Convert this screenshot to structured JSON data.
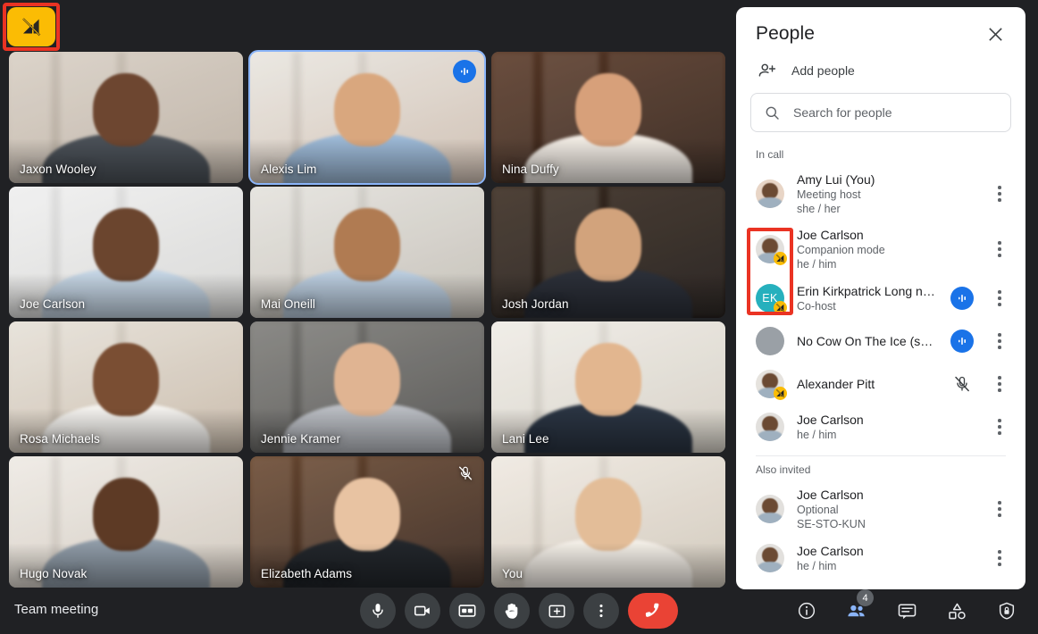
{
  "app": {
    "background_color": "#202124",
    "meeting_title": "Team meeting"
  },
  "highlight": {
    "button_icon": "network-off-icon",
    "button_color": "#fbbc04",
    "outline_color": "#ea3323"
  },
  "grid": {
    "tiles": [
      {
        "name": "Jaxon Wooley",
        "active_speaker": false,
        "audio_indicator": false,
        "muted": false,
        "skin": "#6d4630",
        "shirt": "#4a5057",
        "bg1": "#d8cfc4",
        "bg2": "#b9ada0"
      },
      {
        "name": "Alexis Lim",
        "active_speaker": true,
        "audio_indicator": true,
        "muted": false,
        "skin": "#d9a77e",
        "shirt": "#9bb7d4",
        "bg1": "#e9e6e0",
        "bg2": "#cdbcae"
      },
      {
        "name": "Nina Duffy",
        "active_speaker": false,
        "audio_indicator": false,
        "muted": false,
        "skin": "#d7a07a",
        "shirt": "#f0eae3",
        "bg1": "#5a3a28",
        "bg2": "#2e1d14"
      },
      {
        "name": "Joe Carlson",
        "active_speaker": false,
        "audio_indicator": false,
        "muted": false,
        "skin": "#6b452e",
        "shirt": "#c3d3e2",
        "bg1": "#efefef",
        "bg2": "#d6d6d4"
      },
      {
        "name": "Mai Oneill",
        "active_speaker": false,
        "audio_indicator": false,
        "muted": false,
        "skin": "#b07b52",
        "shirt": "#b9cbdd",
        "bg1": "#e4e2dd",
        "bg2": "#c2bdb4"
      },
      {
        "name": "Josh Jordan",
        "active_speaker": false,
        "audio_indicator": false,
        "muted": false,
        "skin": "#d2a37c",
        "shirt": "#2b2f38",
        "bg1": "#3b2d22",
        "bg2": "#191310"
      },
      {
        "name": "Rosa Michaels",
        "active_speaker": false,
        "audio_indicator": false,
        "muted": false,
        "skin": "#7a4e33",
        "shirt": "#f2f0ec",
        "bg1": "#e6e1d8",
        "bg2": "#c6b7a6"
      },
      {
        "name": "Jennie Kramer",
        "active_speaker": false,
        "audio_indicator": false,
        "muted": false,
        "skin": "#e0b492",
        "shirt": "#b9bcc2",
        "bg1": "#7e7d79",
        "bg2": "#4c4b49"
      },
      {
        "name": "Lani Lee",
        "active_speaker": false,
        "audio_indicator": false,
        "muted": false,
        "skin": "#e2b68f",
        "shirt": "#2a3442",
        "bg1": "#efece6",
        "bg2": "#d4cec3"
      },
      {
        "name": "Hugo Novak",
        "active_speaker": false,
        "audio_indicator": false,
        "muted": false,
        "skin": "#5d3a25",
        "shirt": "#8e9aa6",
        "bg1": "#eeeae4",
        "bg2": "#cfc6bb"
      },
      {
        "name": "Elizabeth Adams",
        "active_speaker": false,
        "audio_indicator": false,
        "muted": true,
        "skin": "#e8c3a2",
        "shirt": "#22262b",
        "bg1": "#6b4a32",
        "bg2": "#332118"
      },
      {
        "name": "You",
        "active_speaker": false,
        "audio_indicator": false,
        "muted": false,
        "skin": "#e3bd98",
        "shirt": "#f1ece5",
        "bg1": "#efe9e1",
        "bg2": "#cfc6b8"
      }
    ]
  },
  "panel": {
    "title": "People",
    "close_icon": "close-icon",
    "add_people": {
      "label": "Add people",
      "icon": "person-add-icon"
    },
    "search": {
      "placeholder": "Search for people",
      "value": "",
      "icon": "search-icon"
    },
    "sections": [
      {
        "label": "In call",
        "people": [
          {
            "name": "Amy Lui (You)",
            "sub1": "Meeting host",
            "sub2": "she / her",
            "avatar_type": "photo",
            "avatar_color": "#e8d5c6",
            "badge": null,
            "audio_indicator": false,
            "muted": false,
            "menu": true
          },
          {
            "name": "Joe Carlson",
            "sub1": "Companion mode",
            "sub2": "he / him",
            "avatar_type": "photo",
            "avatar_color": "#e2e0dd",
            "badge": "companion-mode-icon",
            "audio_indicator": false,
            "muted": false,
            "menu": true
          },
          {
            "name": "Erin Kirkpatrick Long nam...",
            "sub1": "Co-host",
            "sub2": "",
            "avatar_type": "initials",
            "initials": "EK",
            "avatar_color": "#26b0bd",
            "badge": "companion-mode-icon",
            "audio_indicator": true,
            "muted": false,
            "menu": true
          },
          {
            "name": "No Cow On The Ice (se-sto..",
            "sub1": "",
            "sub2": "",
            "avatar_type": "blank",
            "avatar_color": "#9aa0a6",
            "badge": null,
            "audio_indicator": true,
            "muted": false,
            "menu": true
          },
          {
            "name": "Alexander Pitt",
            "sub1": "",
            "sub2": "",
            "avatar_type": "photo",
            "avatar_color": "#e6e3de",
            "badge": "companion-mode-icon",
            "audio_indicator": false,
            "muted": true,
            "menu": true
          },
          {
            "name": "Joe Carlson",
            "sub1": "he / him",
            "sub2": "",
            "avatar_type": "photo",
            "avatar_color": "#e2e0dd",
            "badge": null,
            "audio_indicator": false,
            "muted": false,
            "menu": true
          }
        ]
      },
      {
        "label": "Also invited",
        "people": [
          {
            "name": "Joe Carlson",
            "sub1": "Optional",
            "sub2": "SE-STO-KUN",
            "avatar_type": "photo",
            "avatar_color": "#e2e0dd",
            "badge": null,
            "audio_indicator": false,
            "muted": false,
            "menu": true
          },
          {
            "name": "Joe Carlson",
            "sub1": "he / him",
            "sub2": "",
            "avatar_type": "photo",
            "avatar_color": "#e2e0dd",
            "badge": null,
            "audio_indicator": false,
            "muted": false,
            "menu": true
          }
        ]
      }
    ],
    "row_highlight": {
      "outline_color": "#ea3323"
    }
  },
  "bottom_bar": {
    "center_controls": [
      {
        "name": "microphone-button",
        "icon": "mic-icon",
        "style": "normal"
      },
      {
        "name": "camera-button",
        "icon": "video-camera-icon",
        "style": "normal"
      },
      {
        "name": "captions-button",
        "icon": "closed-caption-icon",
        "style": "normal"
      },
      {
        "name": "raise-hand-button",
        "icon": "hand-icon",
        "style": "normal"
      },
      {
        "name": "present-screen-button",
        "icon": "present-screen-icon",
        "style": "normal"
      },
      {
        "name": "more-options-button",
        "icon": "more-vertical-icon",
        "style": "normal"
      },
      {
        "name": "end-call-button",
        "icon": "call-end-icon",
        "style": "end"
      }
    ],
    "right_controls": [
      {
        "name": "meeting-details-button",
        "icon": "info-icon",
        "active": false,
        "badge": null
      },
      {
        "name": "people-button",
        "icon": "people-icon",
        "active": true,
        "badge": "4"
      },
      {
        "name": "chat-button",
        "icon": "chat-icon",
        "active": false,
        "badge": null
      },
      {
        "name": "activities-button",
        "icon": "activities-icon",
        "active": false,
        "badge": null
      },
      {
        "name": "host-controls-button",
        "icon": "shield-lock-icon",
        "active": false,
        "badge": null
      }
    ],
    "active_color": "#8ab4f8",
    "end_call_color": "#ea4335"
  }
}
